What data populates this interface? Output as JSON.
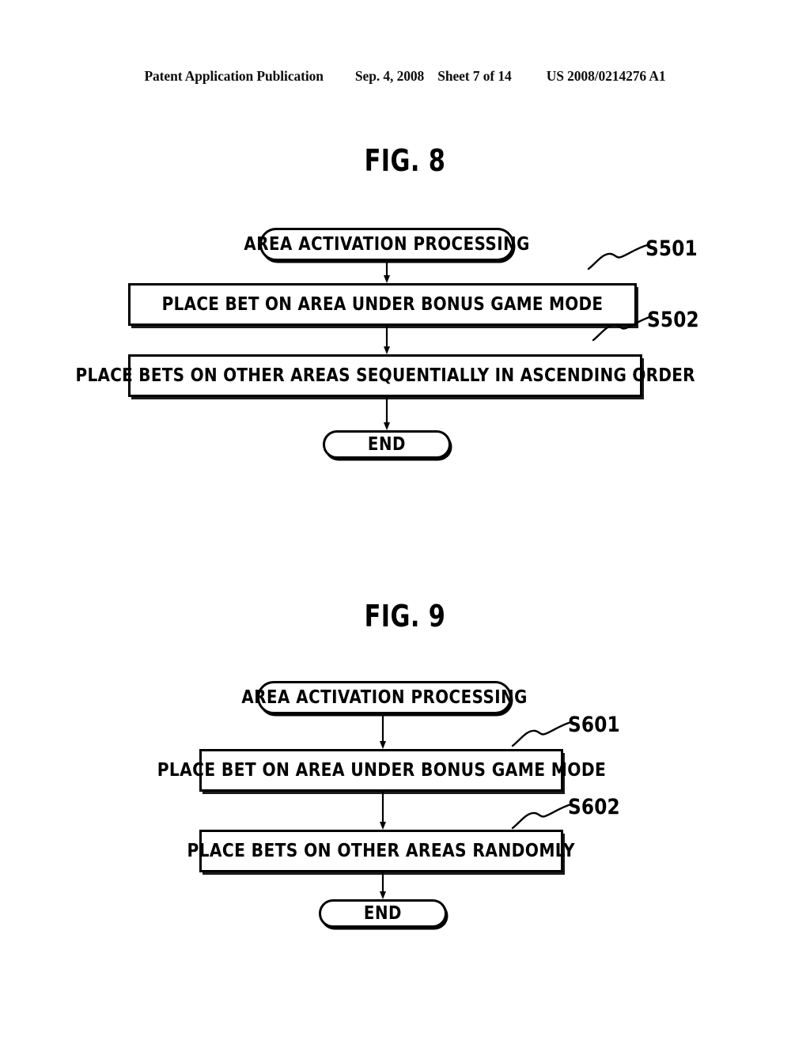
{
  "header": {
    "publication": "Patent Application Publication",
    "date": "Sep. 4, 2008",
    "sheet": "Sheet 7 of 14",
    "doc_number": "US 2008/0214276 A1"
  },
  "figures": [
    {
      "title": "FIG. 8",
      "nodes": {
        "start": "AREA ACTIVATION PROCESSING",
        "step1": "PLACE BET ON AREA UNDER BONUS GAME MODE",
        "step2": "PLACE BETS ON OTHER AREAS SEQUENTIALLY IN ASCENDING ORDER",
        "end": "END"
      },
      "refs": {
        "ref1": "S501",
        "ref2": "S502"
      }
    },
    {
      "title": "FIG. 9",
      "nodes": {
        "start": "AREA ACTIVATION PROCESSING",
        "step1": "PLACE BET ON AREA UNDER BONUS GAME MODE",
        "step2": "PLACE BETS ON OTHER AREAS RANDOMLY",
        "end": "END"
      },
      "refs": {
        "ref1": "S601",
        "ref2": "S602"
      }
    }
  ],
  "colors": {
    "ink": "#000000",
    "paper": "#ffffff"
  }
}
